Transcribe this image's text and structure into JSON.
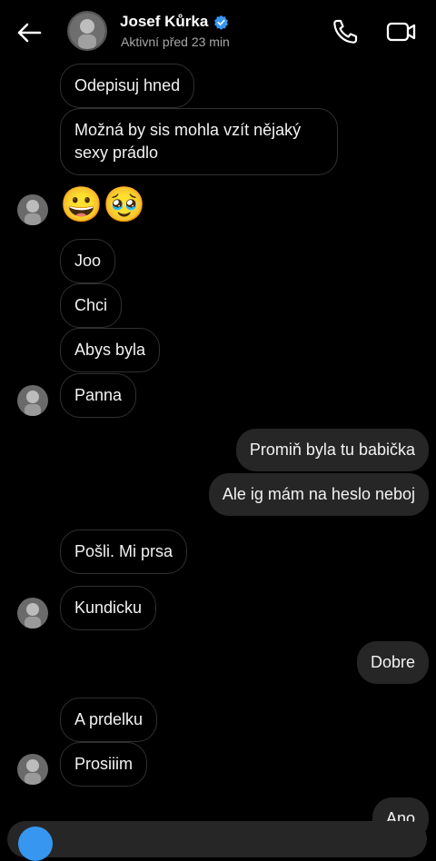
{
  "header": {
    "name": "Josef Kůrka",
    "status": "Aktivní před 23 min"
  },
  "icons": {
    "back": "arrow-left-icon",
    "verified": "verified-badge-icon",
    "call": "phone-icon",
    "video": "video-camera-icon"
  },
  "colors": {
    "background": "#000000",
    "incoming_border": "#303030",
    "outgoing_bg": "#262626",
    "verified": "#3797f0",
    "secondary_text": "#a8a8a8"
  },
  "messages": [
    {
      "side": "in",
      "text": "Odepisuj hned"
    },
    {
      "side": "in",
      "text": "Možná by sis mohla vzít nějaký sexy prádlo"
    },
    {
      "side": "in",
      "text": "😀🥹",
      "emoji": true
    },
    {
      "side": "in",
      "text": "Joo"
    },
    {
      "side": "in",
      "text": "Chci"
    },
    {
      "side": "in",
      "text": "Abys byla"
    },
    {
      "side": "in",
      "text": "Panna"
    },
    {
      "side": "out",
      "text": "Promiň byla tu babička"
    },
    {
      "side": "out",
      "text": "Ale ig mám na heslo neboj"
    },
    {
      "side": "in",
      "text": "Pošli. Mi prsa"
    },
    {
      "side": "in",
      "text": "Kundicku"
    },
    {
      "side": "out",
      "text": "Dobre"
    },
    {
      "side": "in",
      "text": "A prdelku"
    },
    {
      "side": "in",
      "text": "Prosiiim"
    },
    {
      "side": "out",
      "text": "Ano"
    }
  ]
}
